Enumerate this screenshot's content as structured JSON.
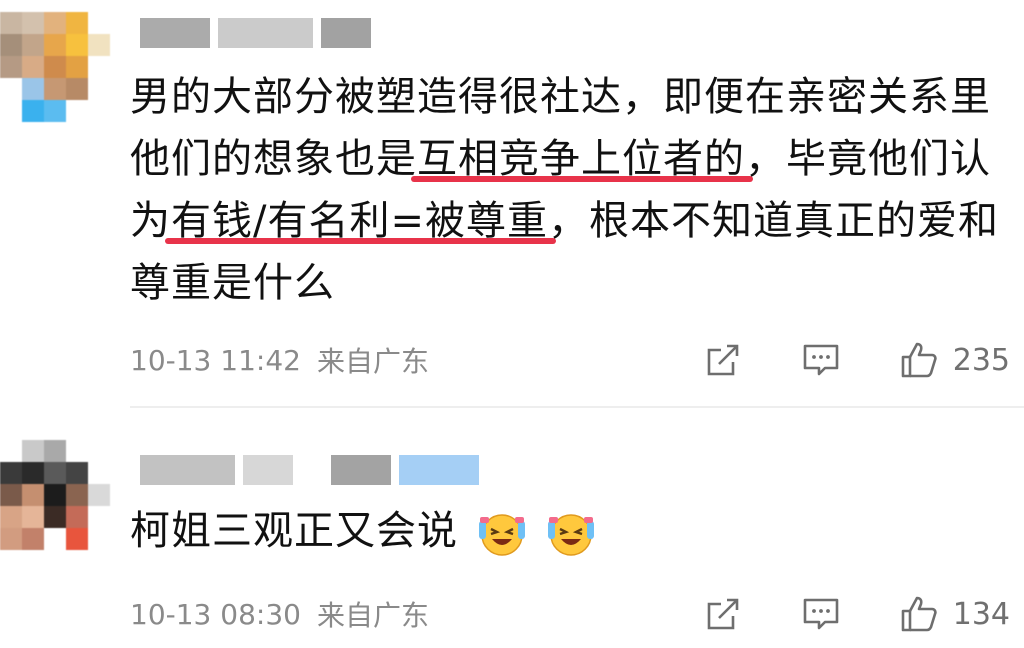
{
  "comments": [
    {
      "text_parts": [
        {
          "t": "男的大部分被塑造得很社达，即便在亲密关系里他们的想象也是",
          "hl": false
        },
        {
          "t": "互相竞争上位者的",
          "hl": true
        },
        {
          "t": "，毕竟他们认为",
          "hl": false
        },
        {
          "t": "有钱/有名利=被尊重",
          "hl": true
        },
        {
          "t": "，根本不知道真正的爱和尊重是什么",
          "hl": false
        }
      ],
      "time": "10-13 11:42",
      "location": "来自广东",
      "likes": "235"
    },
    {
      "text_parts": [
        {
          "t": "柯姐三观正又会说",
          "hl": false
        }
      ],
      "time": "10-13 08:30",
      "location": "来自广东",
      "likes": "134"
    }
  ],
  "colors": {
    "highlight": "#e8334a",
    "meta_text": "#8a8a8a"
  },
  "icons": [
    "share-icon",
    "comment-icon",
    "like-icon",
    "laugh-cry-emoji"
  ]
}
